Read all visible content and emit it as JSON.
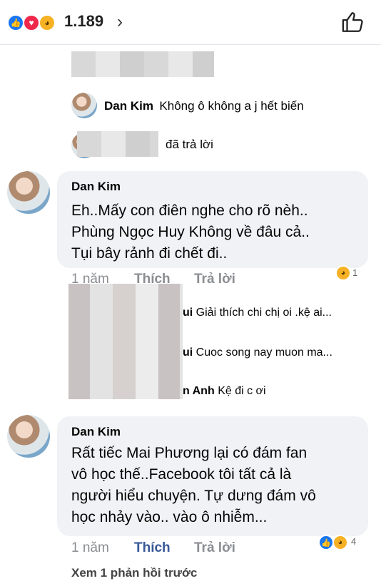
{
  "reactions": {
    "count": "1.189",
    "like_icon": "like-icon",
    "love_icon": "love-icon",
    "haha_icon": "haha-icon"
  },
  "replies_preview": [
    {
      "author": "Dan Kim",
      "text": "Không ô không a j hết biến"
    },
    {
      "suffix": "đã trả lời"
    }
  ],
  "comments": [
    {
      "author": "Dan Kim",
      "lines": [
        "Eh..Mấy con điên nghe cho rõ nèh..",
        "Phùng Ngọc Huy Không về đâu cả..",
        "Tụi bây rảnh đi chết đi.."
      ],
      "time": "1 năm",
      "like": "Thích",
      "reply": "Trả lời",
      "reaction_count": "1"
    },
    {
      "author": "Dan Kim",
      "lines": [
        "Rất tiếc Mai Phương lại có đám fan",
        "vô học thế..Facebook tôi tất cả là",
        "người hiểu chuyện. Tự dưng đám vô",
        "học nhảy vào.. vào ô nhiễm..."
      ],
      "time": "1 năm",
      "like": "Thích",
      "reply": "Trả lời",
      "reaction_count": "4"
    }
  ],
  "nested_replies": [
    {
      "name_tail": "ui",
      "text": "Giải thích chi chị oi .kệ  ai..."
    },
    {
      "name_tail": "ui",
      "text": "Cuoc song nay muon ma..."
    },
    {
      "name_tail": "n Anh",
      "text": "Kệ đi c ơi"
    }
  ],
  "view_previous": "Xem 1 phản hồi trước"
}
